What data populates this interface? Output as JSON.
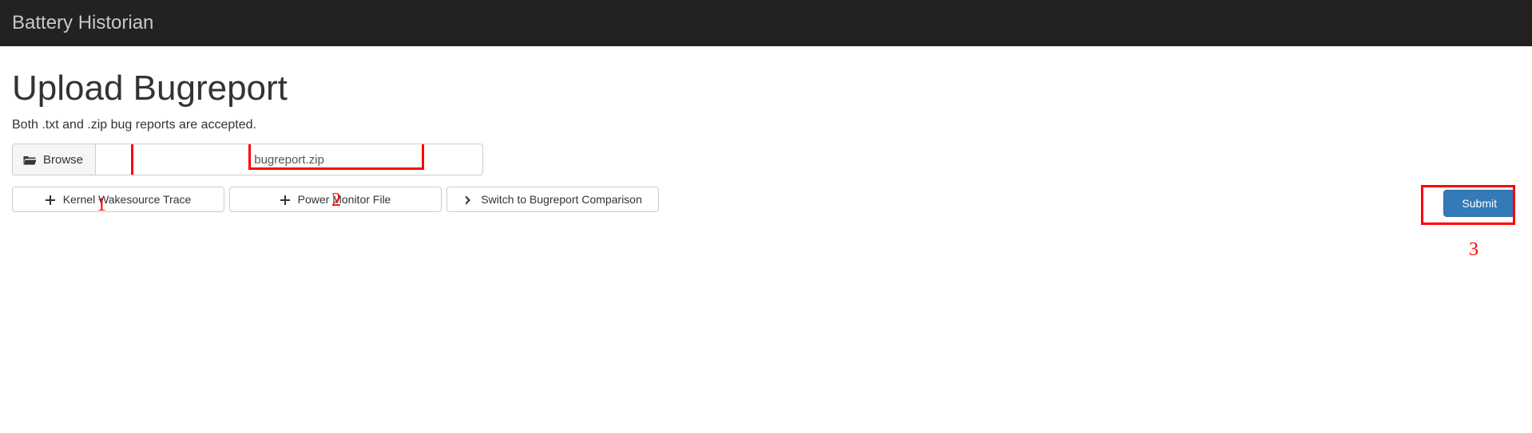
{
  "header": {
    "brand": "Battery Historian"
  },
  "page": {
    "title": "Upload Bugreport",
    "subtitle": "Both .txt and .zip bug reports are accepted."
  },
  "upload": {
    "browse_label": "Browse",
    "file_name": "bugreport.zip"
  },
  "buttons": {
    "kernel": "Kernel Wakesource Trace",
    "power": "Power Monitor File",
    "switch": "Switch to Bugreport Comparison",
    "submit": "Submit"
  },
  "annotations": {
    "n1": "1",
    "n2": "2",
    "n3": "3"
  }
}
